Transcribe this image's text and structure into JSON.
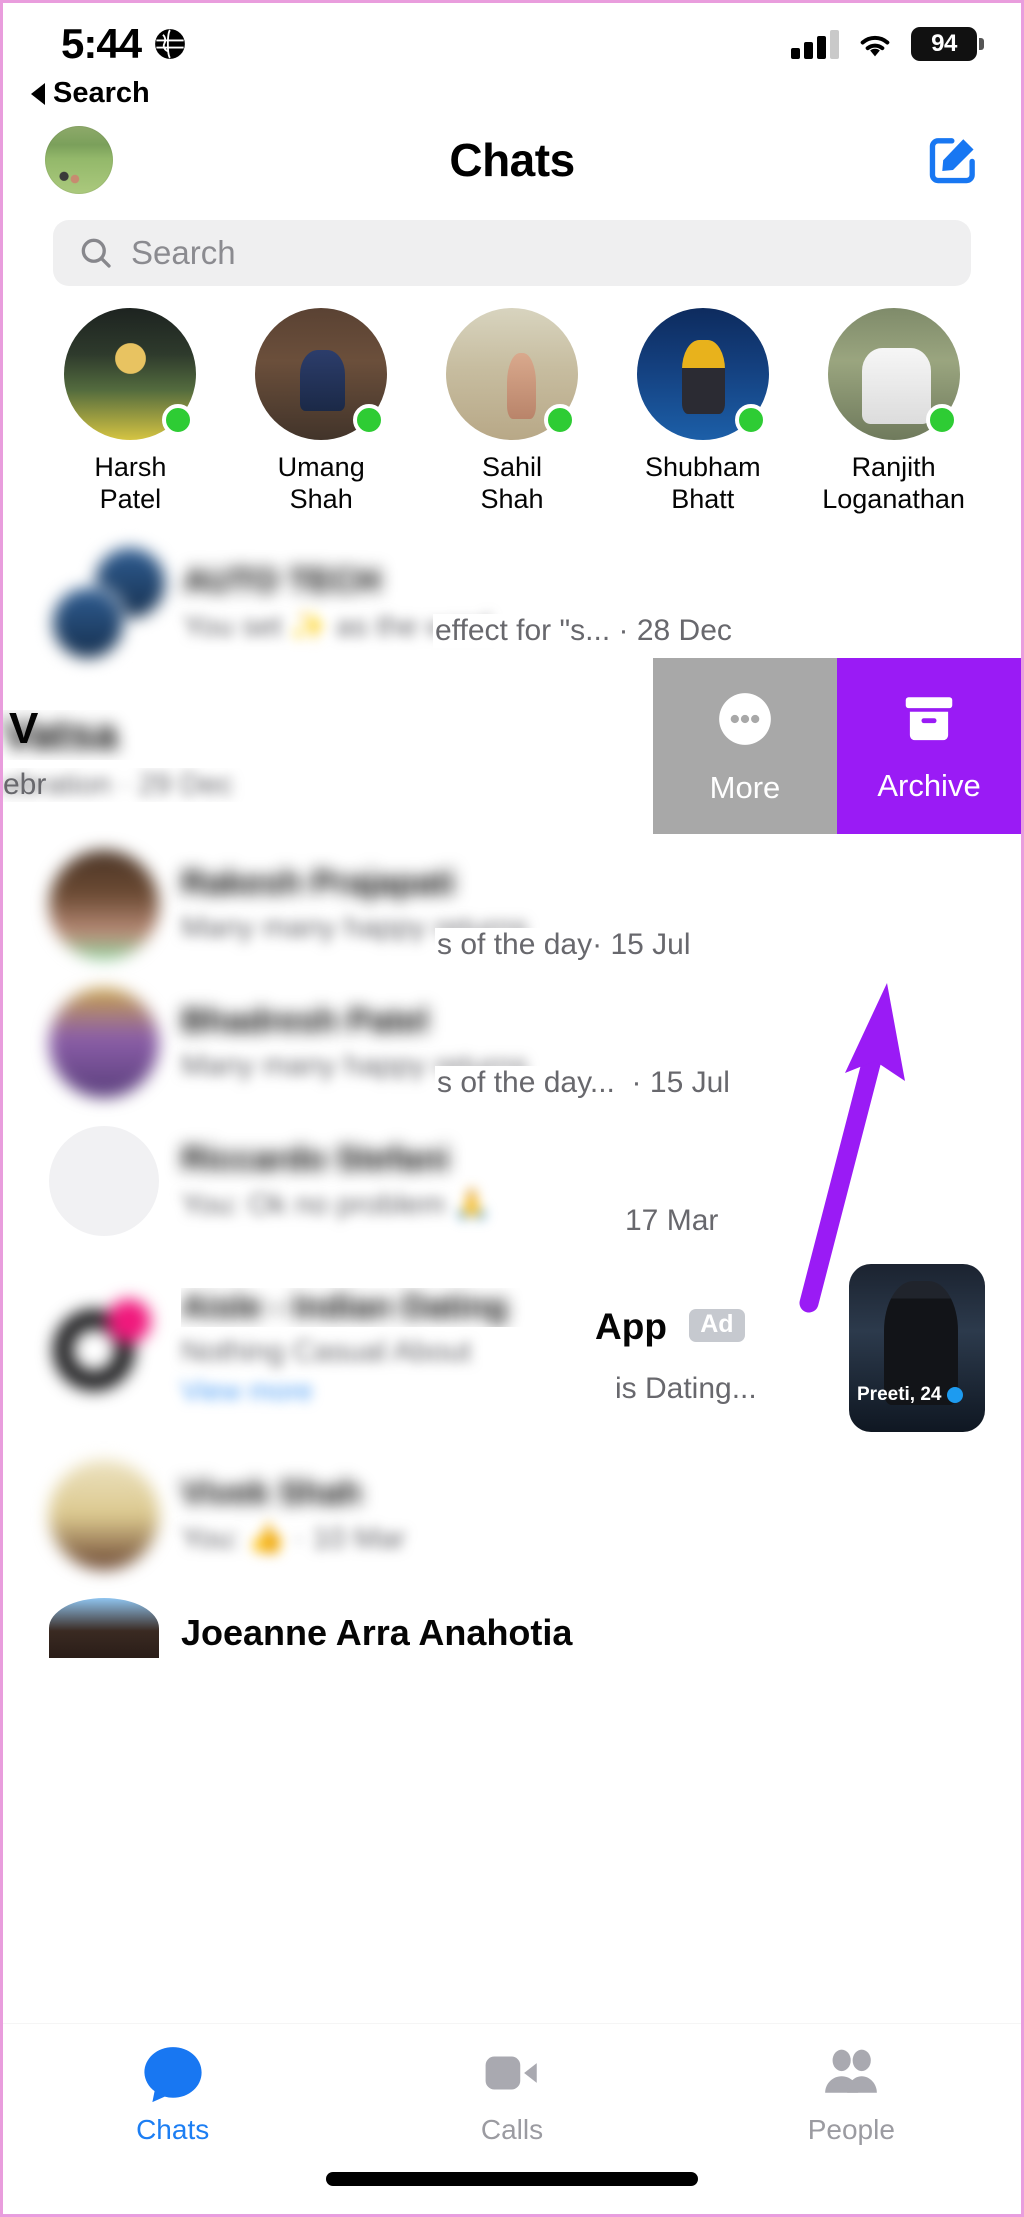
{
  "status_bar": {
    "time": "5:44",
    "location_icon": "globe-icon",
    "signal_icon": "cellular-signal-icon",
    "wifi_icon": "wifi-icon",
    "battery_level": "94"
  },
  "back_link": {
    "label": "Search"
  },
  "nav": {
    "title": "Chats",
    "avatar_name": "profile-avatar",
    "compose_icon": "compose-icon"
  },
  "search": {
    "placeholder": "Search",
    "icon": "search-icon"
  },
  "active_contacts": [
    {
      "name_line1": "Harsh",
      "name_line2": "Patel",
      "online": true
    },
    {
      "name_line1": "Umang",
      "name_line2": "Shah",
      "online": true
    },
    {
      "name_line1": "Sahil",
      "name_line2": "Shah",
      "online": true
    },
    {
      "name_line1": "Shubham",
      "name_line2": "Bhatt",
      "online": true
    },
    {
      "name_line1": "Ranjith",
      "name_line2": "Loganathan",
      "online": true
    }
  ],
  "swipe_actions": {
    "more": {
      "label": "More",
      "icon": "ellipsis-circle-icon",
      "color": "#a8a8a8"
    },
    "archive": {
      "label": "Archive",
      "icon": "archive-box-icon",
      "color": "#9a1bf5"
    }
  },
  "chats": [
    {
      "name": "AUTO TECH",
      "snippet_blurred": "You set ✨ as the word",
      "snippet_clear": "effect for \"s...",
      "date": "28 Dec",
      "blurred": true,
      "group": true
    },
    {
      "name": "Vatsa",
      "snippet_blurred": "ebration · 29 Dec",
      "snippet_clear": "",
      "date": "",
      "blurred": true,
      "swiped": true
    },
    {
      "name": "Rakesh Prajapati",
      "snippet_blurred": "Many many happy returns",
      "snippet_clear": "s of the day",
      "date": "15 Jul",
      "blurred": true
    },
    {
      "name": "Bhadresh Patel",
      "snippet_blurred": "Many many happy returns",
      "snippet_clear": "s of the day...",
      "date": "15 Jul",
      "blurred": true
    },
    {
      "name": "Riccardo Stefani",
      "snippet_blurred": "You: Ok no problem 🙏",
      "snippet_clear": "",
      "date": "17 Mar",
      "blurred": true
    },
    {
      "name": "Aisle - Indian Dating",
      "name_clear": "App",
      "ad_badge": "Ad",
      "snippet_blurred": "Nothing Casual About",
      "snippet_clear": "is Dating...",
      "link": "View more",
      "thumb_caption": "Preeti, 24",
      "is_ad": true
    },
    {
      "name": "Vivek Shah",
      "snippet_blurred": "You: 👍 · 10 Mar",
      "snippet_clear": "",
      "date": "",
      "blurred": true
    },
    {
      "name": "Joeanne Arra Anahotia",
      "snippet_blurred": "",
      "snippet_clear": "",
      "date": "",
      "blurred": false,
      "partial": true
    }
  ],
  "tabs": [
    {
      "label": "Chats",
      "icon": "chat-bubble-icon",
      "active": true,
      "color": "#1c7ef3"
    },
    {
      "label": "Calls",
      "icon": "video-camera-icon",
      "active": false,
      "color": "#9b9ba1"
    },
    {
      "label": "People",
      "icon": "people-icon",
      "active": false,
      "color": "#9b9ba1"
    }
  ],
  "annotation": {
    "arrow_color": "#9a1bf5",
    "points_to": "archive-button"
  }
}
